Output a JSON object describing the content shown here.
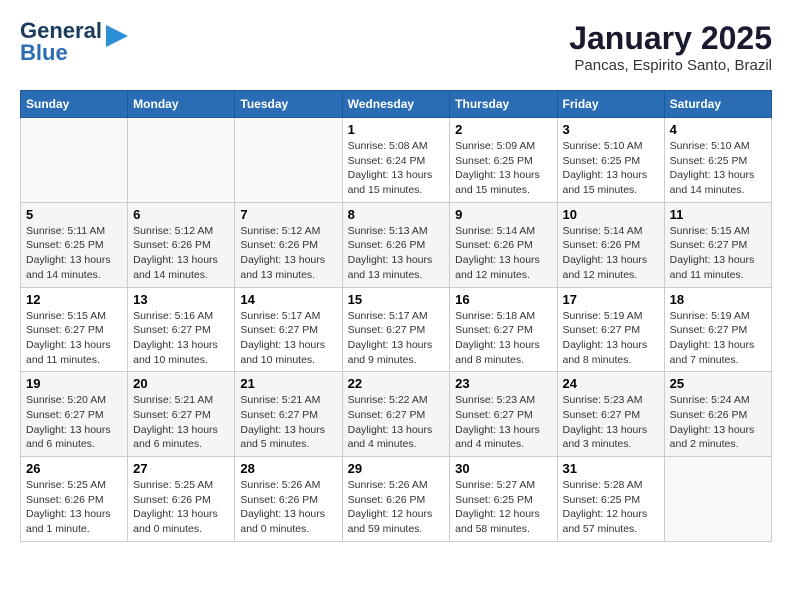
{
  "logo": {
    "part1": "General",
    "part2": "Blue"
  },
  "header": {
    "month": "January 2025",
    "location": "Pancas, Espirito Santo, Brazil"
  },
  "weekdays": [
    "Sunday",
    "Monday",
    "Tuesday",
    "Wednesday",
    "Thursday",
    "Friday",
    "Saturday"
  ],
  "weeks": [
    [
      {
        "day": "",
        "info": ""
      },
      {
        "day": "",
        "info": ""
      },
      {
        "day": "",
        "info": ""
      },
      {
        "day": "1",
        "info": "Sunrise: 5:08 AM\nSunset: 6:24 PM\nDaylight: 13 hours\nand 15 minutes."
      },
      {
        "day": "2",
        "info": "Sunrise: 5:09 AM\nSunset: 6:25 PM\nDaylight: 13 hours\nand 15 minutes."
      },
      {
        "day": "3",
        "info": "Sunrise: 5:10 AM\nSunset: 6:25 PM\nDaylight: 13 hours\nand 15 minutes."
      },
      {
        "day": "4",
        "info": "Sunrise: 5:10 AM\nSunset: 6:25 PM\nDaylight: 13 hours\nand 14 minutes."
      }
    ],
    [
      {
        "day": "5",
        "info": "Sunrise: 5:11 AM\nSunset: 6:25 PM\nDaylight: 13 hours\nand 14 minutes."
      },
      {
        "day": "6",
        "info": "Sunrise: 5:12 AM\nSunset: 6:26 PM\nDaylight: 13 hours\nand 14 minutes."
      },
      {
        "day": "7",
        "info": "Sunrise: 5:12 AM\nSunset: 6:26 PM\nDaylight: 13 hours\nand 13 minutes."
      },
      {
        "day": "8",
        "info": "Sunrise: 5:13 AM\nSunset: 6:26 PM\nDaylight: 13 hours\nand 13 minutes."
      },
      {
        "day": "9",
        "info": "Sunrise: 5:14 AM\nSunset: 6:26 PM\nDaylight: 13 hours\nand 12 minutes."
      },
      {
        "day": "10",
        "info": "Sunrise: 5:14 AM\nSunset: 6:26 PM\nDaylight: 13 hours\nand 12 minutes."
      },
      {
        "day": "11",
        "info": "Sunrise: 5:15 AM\nSunset: 6:27 PM\nDaylight: 13 hours\nand 11 minutes."
      }
    ],
    [
      {
        "day": "12",
        "info": "Sunrise: 5:15 AM\nSunset: 6:27 PM\nDaylight: 13 hours\nand 11 minutes."
      },
      {
        "day": "13",
        "info": "Sunrise: 5:16 AM\nSunset: 6:27 PM\nDaylight: 13 hours\nand 10 minutes."
      },
      {
        "day": "14",
        "info": "Sunrise: 5:17 AM\nSunset: 6:27 PM\nDaylight: 13 hours\nand 10 minutes."
      },
      {
        "day": "15",
        "info": "Sunrise: 5:17 AM\nSunset: 6:27 PM\nDaylight: 13 hours\nand 9 minutes."
      },
      {
        "day": "16",
        "info": "Sunrise: 5:18 AM\nSunset: 6:27 PM\nDaylight: 13 hours\nand 8 minutes."
      },
      {
        "day": "17",
        "info": "Sunrise: 5:19 AM\nSunset: 6:27 PM\nDaylight: 13 hours\nand 8 minutes."
      },
      {
        "day": "18",
        "info": "Sunrise: 5:19 AM\nSunset: 6:27 PM\nDaylight: 13 hours\nand 7 minutes."
      }
    ],
    [
      {
        "day": "19",
        "info": "Sunrise: 5:20 AM\nSunset: 6:27 PM\nDaylight: 13 hours\nand 6 minutes."
      },
      {
        "day": "20",
        "info": "Sunrise: 5:21 AM\nSunset: 6:27 PM\nDaylight: 13 hours\nand 6 minutes."
      },
      {
        "day": "21",
        "info": "Sunrise: 5:21 AM\nSunset: 6:27 PM\nDaylight: 13 hours\nand 5 minutes."
      },
      {
        "day": "22",
        "info": "Sunrise: 5:22 AM\nSunset: 6:27 PM\nDaylight: 13 hours\nand 4 minutes."
      },
      {
        "day": "23",
        "info": "Sunrise: 5:23 AM\nSunset: 6:27 PM\nDaylight: 13 hours\nand 4 minutes."
      },
      {
        "day": "24",
        "info": "Sunrise: 5:23 AM\nSunset: 6:27 PM\nDaylight: 13 hours\nand 3 minutes."
      },
      {
        "day": "25",
        "info": "Sunrise: 5:24 AM\nSunset: 6:26 PM\nDaylight: 13 hours\nand 2 minutes."
      }
    ],
    [
      {
        "day": "26",
        "info": "Sunrise: 5:25 AM\nSunset: 6:26 PM\nDaylight: 13 hours\nand 1 minute."
      },
      {
        "day": "27",
        "info": "Sunrise: 5:25 AM\nSunset: 6:26 PM\nDaylight: 13 hours\nand 0 minutes."
      },
      {
        "day": "28",
        "info": "Sunrise: 5:26 AM\nSunset: 6:26 PM\nDaylight: 13 hours\nand 0 minutes."
      },
      {
        "day": "29",
        "info": "Sunrise: 5:26 AM\nSunset: 6:26 PM\nDaylight: 12 hours\nand 59 minutes."
      },
      {
        "day": "30",
        "info": "Sunrise: 5:27 AM\nSunset: 6:25 PM\nDaylight: 12 hours\nand 58 minutes."
      },
      {
        "day": "31",
        "info": "Sunrise: 5:28 AM\nSunset: 6:25 PM\nDaylight: 12 hours\nand 57 minutes."
      },
      {
        "day": "",
        "info": ""
      }
    ]
  ]
}
